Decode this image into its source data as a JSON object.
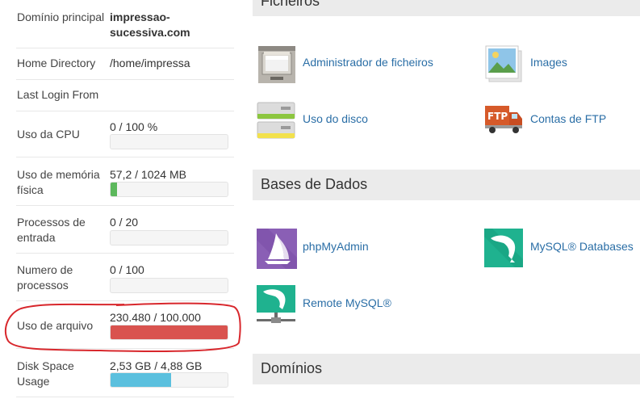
{
  "stats": [
    {
      "label": "Domínio principal",
      "value": "impressao-sucessiva.com"
    },
    {
      "label": "Home Directory",
      "value": "/home/impressa"
    },
    {
      "label": "Last Login From",
      "value": ""
    },
    {
      "label": "Uso da CPU",
      "value": "0 / 100 %",
      "fill": 0,
      "color": "#5cb85c"
    },
    {
      "label": "Uso de memória física",
      "value": "57,2 / 1024 MB",
      "fill": 0.056,
      "color": "#5cb85c"
    },
    {
      "label": "Processos de entrada",
      "value": "0 / 20",
      "fill": 0,
      "color": "#5cb85c"
    },
    {
      "label": "Numero de processos",
      "value": "0 / 100",
      "fill": 0,
      "color": "#5cb85c"
    },
    {
      "label": "Uso de arquivo",
      "value": "230.480 / 100.000",
      "fill": 1.0,
      "color": "#d9534f"
    },
    {
      "label": "Disk Space Usage",
      "value": "2,53 GB / 4,88 GB",
      "fill": 0.518,
      "color": "#5bc0de"
    }
  ],
  "sections": {
    "files": {
      "title": "Ficheiros",
      "tools": {
        "file_manager": "Administrador de ficheiros",
        "images": "Images",
        "disk_usage": "Uso do disco",
        "ftp_accounts": "Contas de FTP"
      }
    },
    "databases": {
      "title": "Bases de Dados",
      "tools": {
        "phpmyadmin": "phpMyAdmin",
        "mysql_databases": "MySQL® Databases",
        "remote_mysql": "Remote MySQL®"
      }
    },
    "domains": {
      "title": "Domínios"
    }
  },
  "icons": {
    "file_manager": "file-cabinet-icon",
    "images": "picture-stack-icon",
    "disk_usage": "hard-drive-icon",
    "ftp_accounts": "ftp-truck-icon",
    "phpmyadmin": "phpmyadmin-sail-icon",
    "mysql_databases": "mysql-dolphin-icon",
    "remote_mysql": "remote-mysql-dolphin-icon"
  }
}
